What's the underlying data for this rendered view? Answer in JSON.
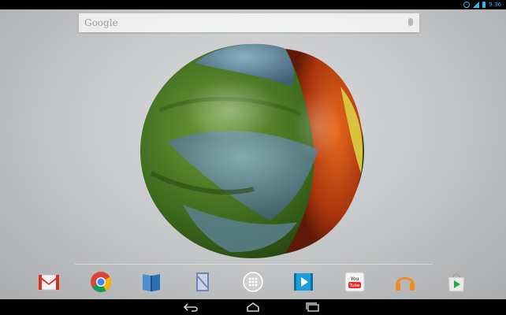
{
  "statusbar": {
    "time": "9:36"
  },
  "search": {
    "label": "Google"
  },
  "dock": {
    "apps": [
      {
        "name": "Gmail",
        "icon": "gmail-icon"
      },
      {
        "name": "Chrome",
        "icon": "chrome-icon"
      },
      {
        "name": "Play Books",
        "icon": "play-books-icon"
      },
      {
        "name": "Play Magazines",
        "icon": "magazines-icon"
      },
      {
        "name": "All Apps",
        "icon": "app-drawer-icon"
      },
      {
        "name": "Play Movies",
        "icon": "play-movies-icon"
      },
      {
        "name": "YouTube",
        "icon": "youtube-icon"
      },
      {
        "name": "Play Music",
        "icon": "headphones-icon"
      },
      {
        "name": "Play Store",
        "icon": "play-store-icon"
      }
    ],
    "youtube_text": "YouTube"
  },
  "nav": {
    "back": "back-icon",
    "home": "home-icon",
    "recents": "recents-icon"
  },
  "colors": {
    "accent": "#33b5e5",
    "youtube_red": "#e52d27",
    "chrome_red": "#db4437",
    "chrome_green": "#0f9d58",
    "chrome_yellow": "#f4b400",
    "chrome_blue": "#4285f4"
  }
}
